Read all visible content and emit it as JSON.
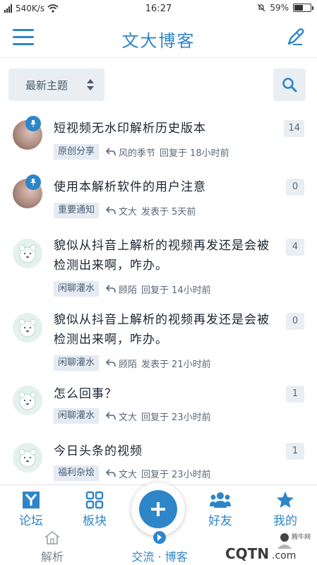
{
  "status_bar": {
    "network_speed": "540K/s",
    "time": "16:27",
    "battery": "59%",
    "battery_level": 0.59
  },
  "app_bar": {
    "title": "文大博客",
    "menu_icon": "hamburger-menu-icon",
    "edit_icon": "pen-icon"
  },
  "filter": {
    "sort_label": "最新主题",
    "sort_icon": "sort-updown-icon",
    "search_icon": "search-icon"
  },
  "topics": [
    {
      "title_line1": "短视频无水印解析历史版本",
      "title_line2": "",
      "tag": "原创分享",
      "user": "风的季节",
      "action": "回复于",
      "time": "18小时前",
      "count": "14",
      "pinned": true,
      "avatar": "photo"
    },
    {
      "title_line1": "使用本解析软件的用户注意",
      "title_line2": "",
      "tag": "重要通知",
      "user": "文大",
      "action": "发表于",
      "time": "5天前",
      "count": "0",
      "pinned": true,
      "avatar": "photo"
    },
    {
      "title_line1": "貌似从抖音上解析的视频再发还是会被",
      "title_line2": "检测出来啊，咋办。",
      "tag": "闲聊灌水",
      "user": "顾陌",
      "action": "回复于",
      "time": "14小时前",
      "count": "4",
      "pinned": false,
      "avatar": "bear"
    },
    {
      "title_line1": "貌似从抖音上解析的视频再发还是会被",
      "title_line2": "检测出来啊，咋办。",
      "tag": "闲聊灌水",
      "user": "顾陌",
      "action": "发表于",
      "time": "21小时前",
      "count": "0",
      "pinned": false,
      "avatar": "bear"
    },
    {
      "title_line1": "怎么回事？",
      "title_line2": "",
      "tag": "闲聊灌水",
      "user": "文大",
      "action": "回复于",
      "time": "23小时前",
      "count": "1",
      "pinned": false,
      "avatar": "bear"
    },
    {
      "title_line1": "今日头条的视频",
      "title_line2": "",
      "tag": "福利杂烩",
      "user": "文大",
      "action": "回复于",
      "time": "23小时前",
      "count": "1",
      "pinned": false,
      "avatar": "bear"
    }
  ],
  "bottom_nav": {
    "items": [
      {
        "label": "论坛",
        "icon": "forum-y-icon"
      },
      {
        "label": "板块",
        "icon": "grid-icon"
      },
      {
        "label": "好友",
        "icon": "friends-icon"
      },
      {
        "label": "我的",
        "icon": "star-icon"
      }
    ],
    "fab_icon": "plus-icon",
    "sub_items": [
      {
        "label": "解析",
        "icon": "home-outline-icon"
      },
      {
        "label": "交流 · 博客",
        "icon": "compass-icon"
      }
    ]
  },
  "watermark": {
    "text": "CQTN.com",
    "small_text": "腾牛网"
  },
  "colors": {
    "accent": "#2e86c9",
    "tag_bg": "#e4ebf2",
    "pin": "#2e86c9"
  }
}
